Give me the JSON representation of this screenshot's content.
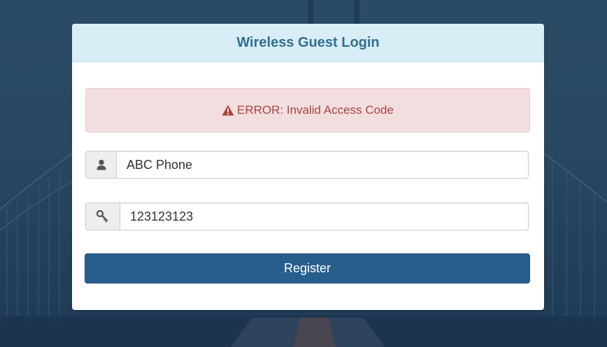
{
  "panel": {
    "title": "Wireless Guest Login"
  },
  "alert": {
    "icon": "warning-icon",
    "message": "ERROR: Invalid Access Code",
    "color": "#a94442"
  },
  "name_field": {
    "icon": "user-icon",
    "value": "ABC Phone"
  },
  "code_field": {
    "icon": "key-icon",
    "value": "123123123"
  },
  "register_button": {
    "label": "Register",
    "color": "#285e8e"
  }
}
